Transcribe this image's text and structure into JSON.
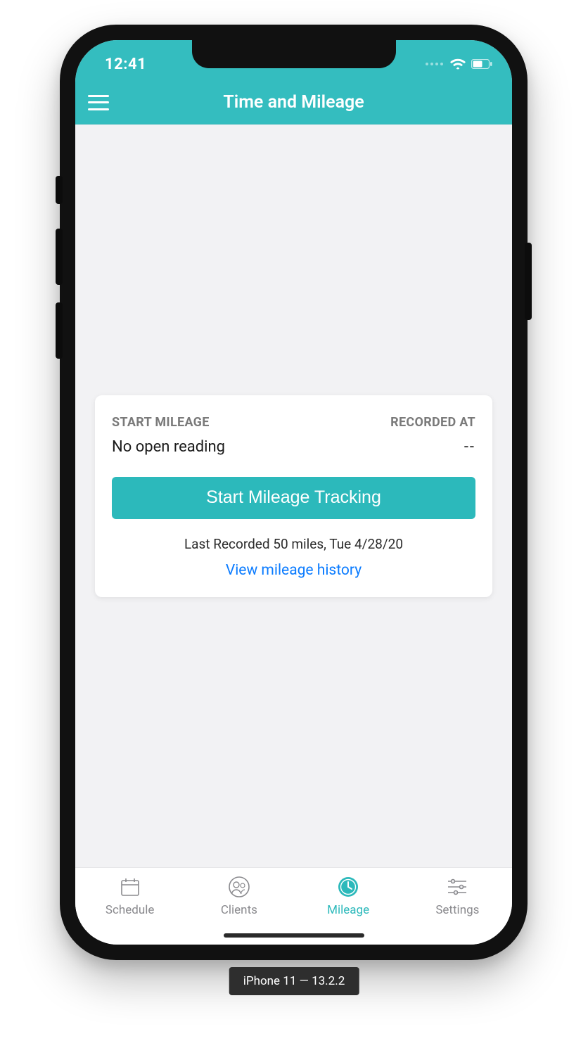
{
  "statusbar": {
    "time": "12:41"
  },
  "navbar": {
    "title": "Time and Mileage"
  },
  "card": {
    "start_label": "START MILEAGE",
    "recorded_label": "RECORDED AT",
    "reading": "No open reading",
    "recorded_value": "--",
    "button_label": "Start Mileage Tracking",
    "last_recorded": "Last Recorded 50 miles, Tue 4/28/20",
    "history_link": "View mileage history"
  },
  "tabs": {
    "schedule": "Schedule",
    "clients": "Clients",
    "mileage": "Mileage",
    "settings": "Settings"
  },
  "caption": "iPhone 11 — 13.2.2",
  "colors": {
    "accent": "#2cb9bb",
    "link": "#0a7bff"
  }
}
